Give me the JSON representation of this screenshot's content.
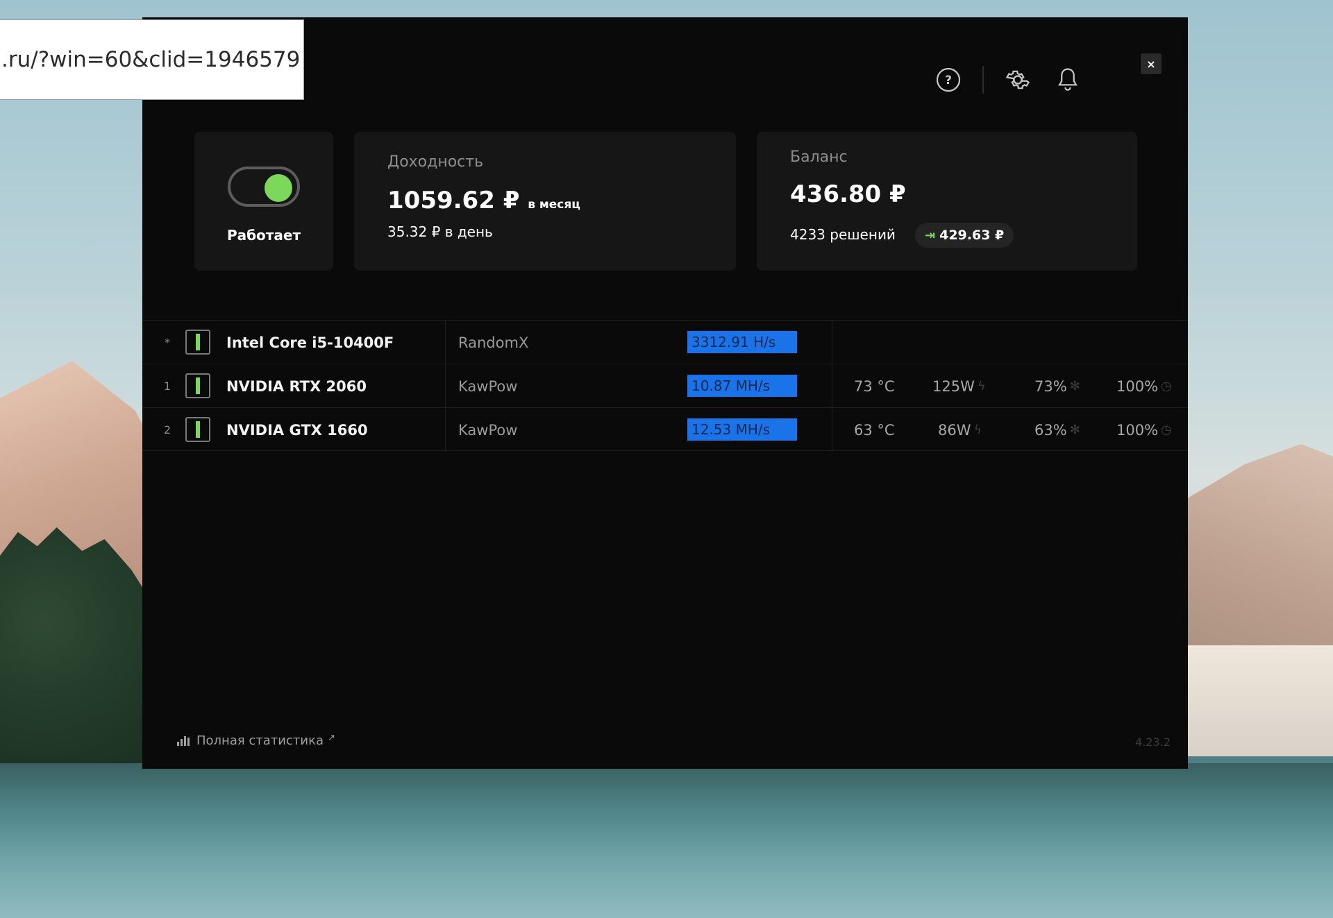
{
  "browser_status": {
    "url_text": ".ru/?win=60&clid=1946579"
  },
  "topbar": {
    "help_icon": "question-circle",
    "settings_icon": "gear",
    "notifications_icon": "bell",
    "close_label": "×"
  },
  "status_card": {
    "label": "Работает",
    "toggle_on": true,
    "accent_color": "#7cd85a"
  },
  "income_card": {
    "label": "Доходность",
    "monthly_value": "1059.62 ₽",
    "monthly_suffix": "в месяц",
    "daily_value": "35.32 ₽ в день"
  },
  "balance_card": {
    "label": "Баланс",
    "value": "436.80 ₽",
    "solutions": "4233 решений",
    "payout": "429.63 ₽"
  },
  "devices": [
    {
      "index": "*",
      "name": "Intel Core i5-10400F",
      "algorithm": "RandomX",
      "speed": "3312.91 H/s",
      "temp": "",
      "power": "",
      "fan": "",
      "load": ""
    },
    {
      "index": "1",
      "name": "NVIDIA RTX 2060",
      "algorithm": "KawPow",
      "speed": "10.87 MH/s",
      "temp": "73 °C",
      "power": "125W",
      "fan": "73%",
      "load": "100%"
    },
    {
      "index": "2",
      "name": "NVIDIA GTX 1660",
      "algorithm": "KawPow",
      "speed": "12.53 MH/s",
      "temp": "63 °C",
      "power": "86W",
      "fan": "63%",
      "load": "100%"
    }
  ],
  "footer": {
    "stats_link": "Полная статистика",
    "stats_arrow": "↗",
    "version": "4.23.2"
  },
  "colors": {
    "window_bg": "#0a0a0a",
    "card_bg": "#161616",
    "speed_highlight": "#1a73e8"
  }
}
